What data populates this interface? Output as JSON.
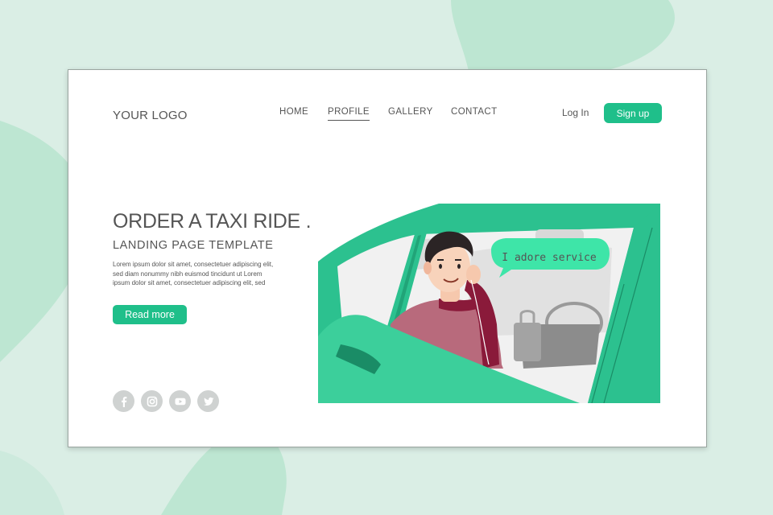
{
  "logo": "YOUR LOGO",
  "nav": {
    "items": [
      "HOME",
      "PROFILE",
      "GALLERY",
      "CONTACT"
    ],
    "active": "PROFILE"
  },
  "auth": {
    "login_label": "Log In",
    "signup_label": "Sign up"
  },
  "hero": {
    "title": "ORDER A TAXI RIDE .",
    "subtitle": "LANDING PAGE TEMPLATE",
    "body_lines": [
      "Lorem ipsum dolor sit amet, consectetuer adipiscing elit,",
      "sed diam nonummy nibh euismod tincidunt ut Lorem",
      "ipsum dolor sit amet, consectetuer adipiscing elit, sed"
    ],
    "cta_label": "Read more"
  },
  "speech_bubble": "I adore service",
  "socials": [
    "facebook-icon",
    "instagram-icon",
    "youtube-icon",
    "twitter-icon"
  ],
  "colors": {
    "accent": "#1fbf8a",
    "car_green": "#2cc18f",
    "background": "#daeee5",
    "blob": "#b8e4cf"
  }
}
